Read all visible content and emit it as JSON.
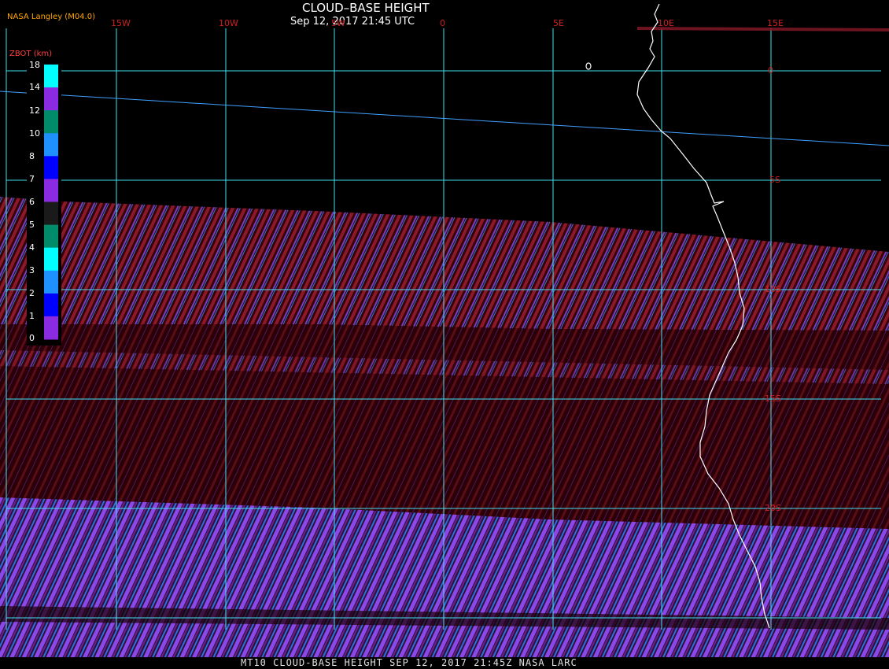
{
  "header": {
    "title": "CLOUD–BASE HEIGHT",
    "subtitle": "Sep 12, 2017 21:45 UTC",
    "credit": "NASA Langley (M04.0)"
  },
  "footer": {
    "text": "MT10  CLOUD-BASE HEIGHT  SEP 12, 2017 21:45Z  NASA LARC"
  },
  "grid": {
    "longitude_labels": [
      "15W",
      "10W",
      "5W",
      "0",
      "5E",
      "10E",
      "15E"
    ],
    "latitude_labels": [
      "0",
      "5S",
      "10S",
      "15S",
      "20S"
    ]
  },
  "colorbar": {
    "title": "ZBOT (km)",
    "labels": [
      "18",
      "14",
      "12",
      "10",
      "8",
      "7",
      "6",
      "5",
      "4",
      "3",
      "2",
      "1",
      "0"
    ],
    "colors": [
      "#00ffff",
      "#8a2be2",
      "#008b6b",
      "#1e90ff",
      "#0000ff",
      "#8a2be2",
      "#1a1a1a",
      "#008b6b",
      "#00ffff",
      "#1e90ff",
      "#0000ff",
      "#8a2be2"
    ]
  },
  "colors": {
    "grid": "#40e0f0",
    "coast": "#ffffff",
    "cloud_dark": "#3a0008",
    "stripe_red": "#7a1020",
    "stripe_purple": "#8040e0",
    "stripe_blue": "#2080ff",
    "label_red": "#cc2020"
  }
}
